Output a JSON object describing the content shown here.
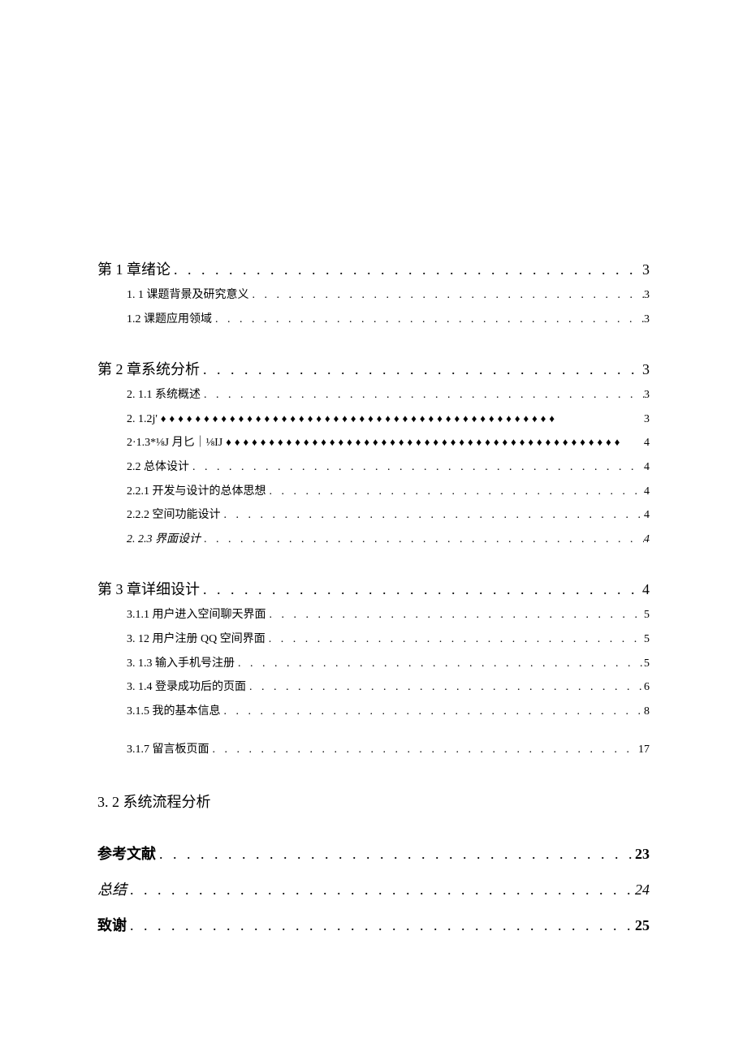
{
  "toc": {
    "e1": {
      "label": "第 1 章绪论",
      "page": "3"
    },
    "e2": {
      "label": "1.  1 课题背景及研究意义",
      "page": "3"
    },
    "e3": {
      "label": "1.2 课题应用领域",
      "page": "3"
    },
    "e4": {
      "label": "第 2 章系统分析",
      "page": "3"
    },
    "e5": {
      "label": "2.  1.1 系统概述",
      "page": "3"
    },
    "e6": {
      "label": "2.  1.2j'",
      "page": "3"
    },
    "e7": {
      "label": "2·1.3*⅛J 月匕｜⅛IJ",
      "page": "4"
    },
    "e8": {
      "label": "2.2 总体设计",
      "page": "4"
    },
    "e9": {
      "label": "2.2.1 开发与设计的总体思想",
      "page": "4"
    },
    "e10": {
      "label": "2.2.2 空间功能设计",
      "page": "4"
    },
    "e11": {
      "label": "2.  2.3 界面设计",
      "page": "4"
    },
    "e12": {
      "label": "第 3 章详细设计",
      "page": "4"
    },
    "e13": {
      "label": "3.1.1 用户进入空间聊天界面",
      "page": "5"
    },
    "e14": {
      "label": "3.  12 用户注册 QQ 空间界面",
      "page": "5"
    },
    "e15": {
      "label": "3.  1.3 输入手机号注册",
      "page": "5"
    },
    "e16": {
      "label": "3.  1.4 登录成功后的页面",
      "page": "6"
    },
    "e17": {
      "label": "3.1.5 我的基本信息",
      "page": "8"
    },
    "e18": {
      "label": "3.1.7 留言板页面",
      "page": "17"
    },
    "h1": {
      "label": "3. 2 系统流程分析"
    },
    "e19": {
      "label": "参考文献",
      "page": "23"
    },
    "e20": {
      "label": "总结",
      "page": "24"
    },
    "e21": {
      "label": "致谢",
      "page": "25"
    }
  },
  "leaders": {
    "dots_wide": ". . . . . . . . . . . . . . . . . . . . . . . . . . . . . . . . . . . . . . . . . . . . . . . . . . . . . . . . . . . . . . . . . . . . . . . . . . . . . . . . . . . . . . . . . . . . . . . . . . . .",
    "diamonds": "♦♦♦♦♦♦♦♦♦♦♦♦♦♦♦♦♦♦♦♦♦♦♦♦♦♦♦♦♦♦♦♦♦♦♦♦♦♦♦♦♦♦♦♦♦♦"
  }
}
